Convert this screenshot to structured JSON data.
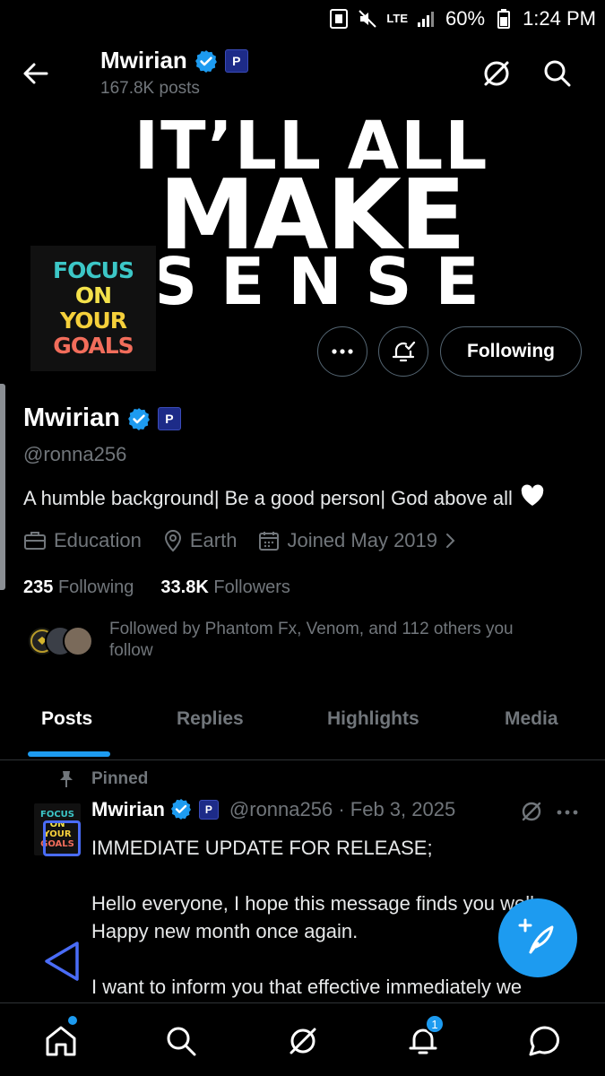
{
  "status_bar": {
    "battery": "60%",
    "time": "1:24 PM",
    "network": "LTE"
  },
  "header": {
    "name": "Mwirian",
    "posts": "167.8K posts",
    "badge": "P"
  },
  "banner": {
    "line1": "IT’LL ALL",
    "line2": "MAKE",
    "line3": "SENSE"
  },
  "avatar": {
    "lines": [
      "FOCUS",
      "ON",
      "YOUR",
      "GOALS"
    ]
  },
  "actions": {
    "following_label": "Following"
  },
  "profile": {
    "name": "Mwirian",
    "handle": "@ronna256",
    "bio": "A humble background| Be a good person| God above all",
    "category": "Education",
    "location": "Earth",
    "joined": "Joined May 2019",
    "following_count": "235",
    "following_label": "Following",
    "followers_count": "33.8K",
    "followers_label": "Followers",
    "followed_by": "Followed by Phantom Fx, Venom, and 112 others you follow"
  },
  "tabs": [
    "Posts",
    "Replies",
    "Highlights",
    "Media"
  ],
  "post": {
    "pinned_label": "Pinned",
    "name": "Mwirian",
    "handle_date": "@ronna256 · Feb 3, 2025",
    "p1": "IMMEDIATE UPDATE FOR RELEASE;",
    "p2": "Hello everyone, I hope this message finds you well. Happy new month once again.",
    "p3": "I want to inform you that effective immediately we"
  },
  "bottom_nav": {
    "notifications_count": "1"
  },
  "colors": {
    "accent": "#1d9bf0",
    "muted": "#71767b",
    "background": "#000000"
  }
}
